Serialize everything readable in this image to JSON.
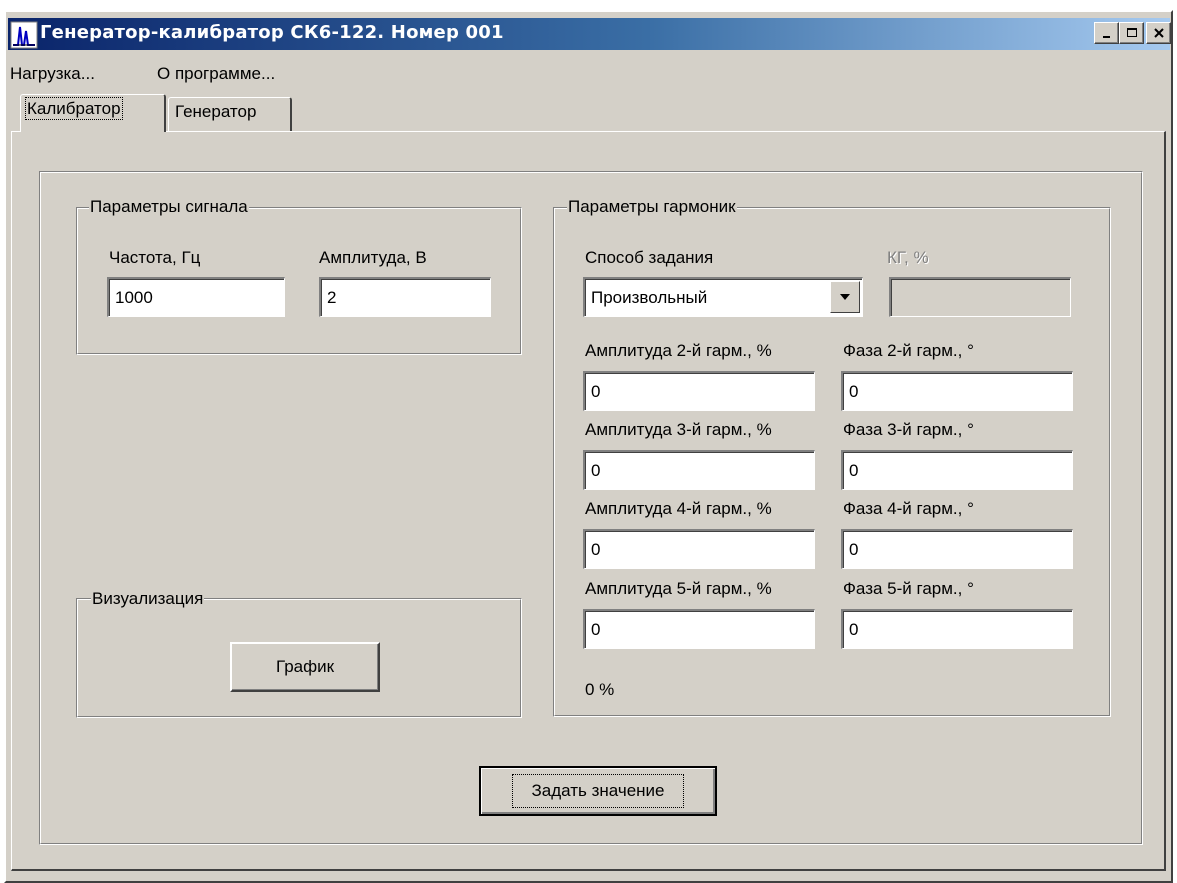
{
  "window": {
    "title": "Генератор-калибратор СК6-122. Номер 001",
    "controls": {
      "minimize_icon": "minimize-icon",
      "maximize_icon": "maximize-icon",
      "close_icon": "close-icon"
    }
  },
  "menu": {
    "items": [
      "Нагрузка...",
      "О программе..."
    ]
  },
  "tabs": [
    {
      "label": "Калибратор",
      "active": true
    },
    {
      "label": "Генератор",
      "active": false
    }
  ],
  "signal_params": {
    "title": "Параметры сигнала",
    "frequency_label": "Частота, Гц",
    "frequency_value": "1000",
    "amplitude_label": "Амплитуда, В",
    "amplitude_value": "2"
  },
  "visualization": {
    "title": "Визуализация",
    "graph_button": "График"
  },
  "harmonics": {
    "title": "Параметры гармоник",
    "method_label": "Способ задания",
    "method_value": "Произвольный",
    "kg_label": "КГ, %",
    "kg_value": "",
    "rows": [
      {
        "amp_label": "Амплитуда 2-й гарм., %",
        "amp_value": "0",
        "phase_label": "Фаза 2-й гарм., °",
        "phase_value": "0"
      },
      {
        "amp_label": "Амплитуда 3-й гарм., %",
        "amp_value": "0",
        "phase_label": "Фаза 3-й гарм., °",
        "phase_value": "0"
      },
      {
        "amp_label": "Амплитуда 4-й гарм., %",
        "amp_value": "0",
        "phase_label": "Фаза 4-й гарм., °",
        "phase_value": "0"
      },
      {
        "amp_label": "Амплитуда 5-й гарм., %",
        "amp_value": "0",
        "phase_label": "Фаза 5-й гарм., °",
        "phase_value": "0"
      }
    ],
    "total_text": "0 %"
  },
  "actions": {
    "set_value_button": "Задать значение"
  },
  "colors": {
    "face": "#d4d0c8",
    "title_start": "#0a246a",
    "title_end": "#a6caf0"
  }
}
